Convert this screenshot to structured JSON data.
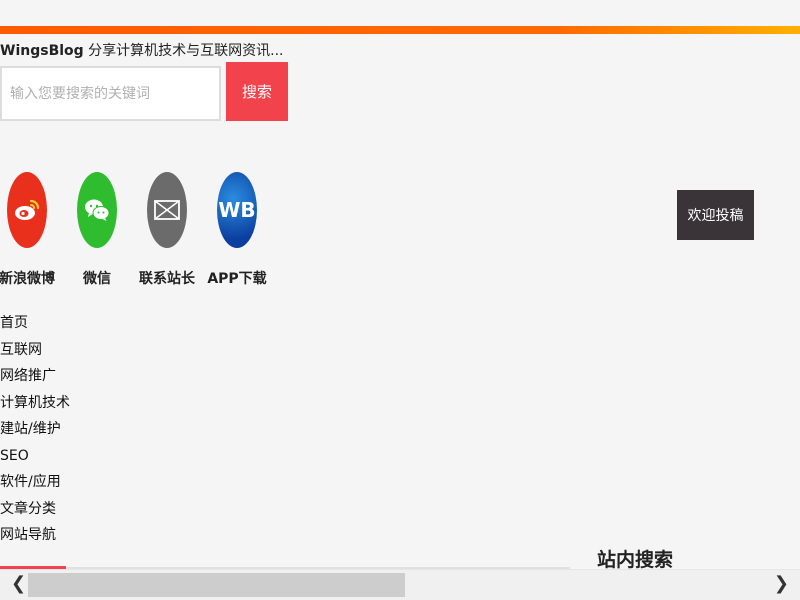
{
  "header": {
    "brand": "WingsBlog",
    "tagline": " 分享计算机技术与互联网资讯..."
  },
  "search": {
    "placeholder": "输入您要搜索的关键词",
    "button_label": "搜索"
  },
  "social": [
    {
      "label": "新浪微博",
      "icon": "weibo-icon"
    },
    {
      "label": "微信",
      "icon": "wechat-icon"
    },
    {
      "label": "联系站长",
      "icon": "mail-icon"
    },
    {
      "label": "APP下载",
      "icon": "app-icon",
      "icon_text": "WB"
    }
  ],
  "contribute_label": "欢迎投稿",
  "nav": [
    "首页",
    "互联网",
    "网络推广",
    "计算机技术",
    "建站/维护",
    "SEO",
    "软件/应用",
    "文章分类",
    "网站导航"
  ],
  "sidebar": {
    "search_title": "站内搜索"
  },
  "colors": {
    "accent": "#f2424b",
    "topbar": "#ff6a00",
    "contribute_bg": "#3a3438"
  },
  "scrollbar": {
    "left_arrow": "❮",
    "right_arrow": "❯"
  }
}
